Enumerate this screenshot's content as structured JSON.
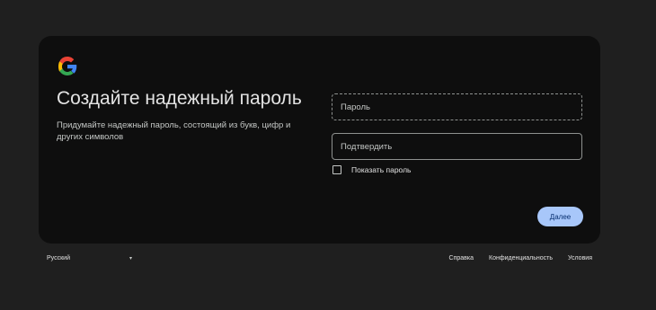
{
  "brand": {
    "logo_icon": "google-g-icon",
    "colors": [
      "#4285f4",
      "#ea4335",
      "#fbbc05",
      "#34a853"
    ]
  },
  "main": {
    "title": "Создайте надежный пароль",
    "subtitle": "Придумайте надежный пароль, состоящий из букв, цифр и других символов"
  },
  "form": {
    "password_placeholder": "Пароль",
    "confirm_placeholder": "Подтвердить",
    "show_password_label": "Показать пароль",
    "show_password_checked": false,
    "next_label": "Далее"
  },
  "footer": {
    "language": "Русский",
    "language_icon": "chevron-down-icon",
    "links": [
      "Справка",
      "Конфиденциальность",
      "Условия"
    ]
  },
  "theme": {
    "background": "#1f1f1f",
    "card": "#0e0e0e",
    "accent": "#a8c7fa"
  }
}
